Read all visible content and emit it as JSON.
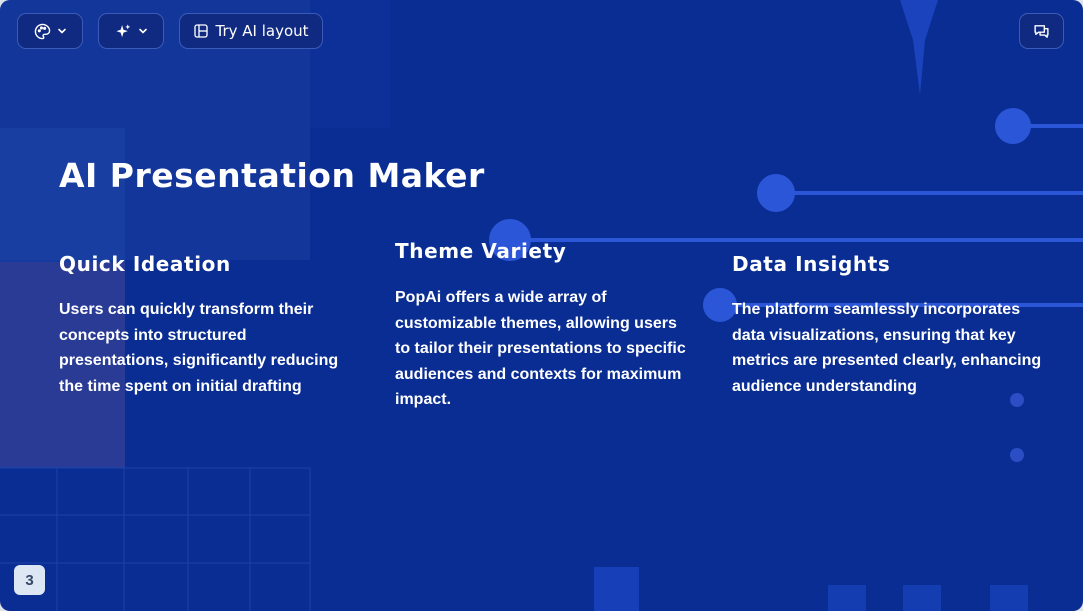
{
  "toolbar": {
    "theme_icon": "palette-icon",
    "ai_icon": "sparkles-icon",
    "layout_icon": "layout-icon",
    "layout_label": "Try AI layout",
    "comment_icon": "comments-icon"
  },
  "slide": {
    "title": "AI Presentation Maker",
    "columns": [
      {
        "heading": "Quick Ideation",
        "body": "Users can quickly transform their concepts into structured presentations, significantly reducing the time spent on initial drafting"
      },
      {
        "heading": "Theme Variety",
        "body": "PopAi offers a wide array of customizable themes, allowing users to tailor their presentations to specific audiences and contexts for maximum impact."
      },
      {
        "heading": "Data Insights",
        "body": "The platform seamlessly incorporates data visualizations, ensuring that key metrics are presented clearly, enhancing audience understanding"
      }
    ],
    "page_number": "3"
  },
  "colors": {
    "background": "#0a2d93",
    "accent_line": "#2b56d8",
    "text": "#ffffff"
  }
}
